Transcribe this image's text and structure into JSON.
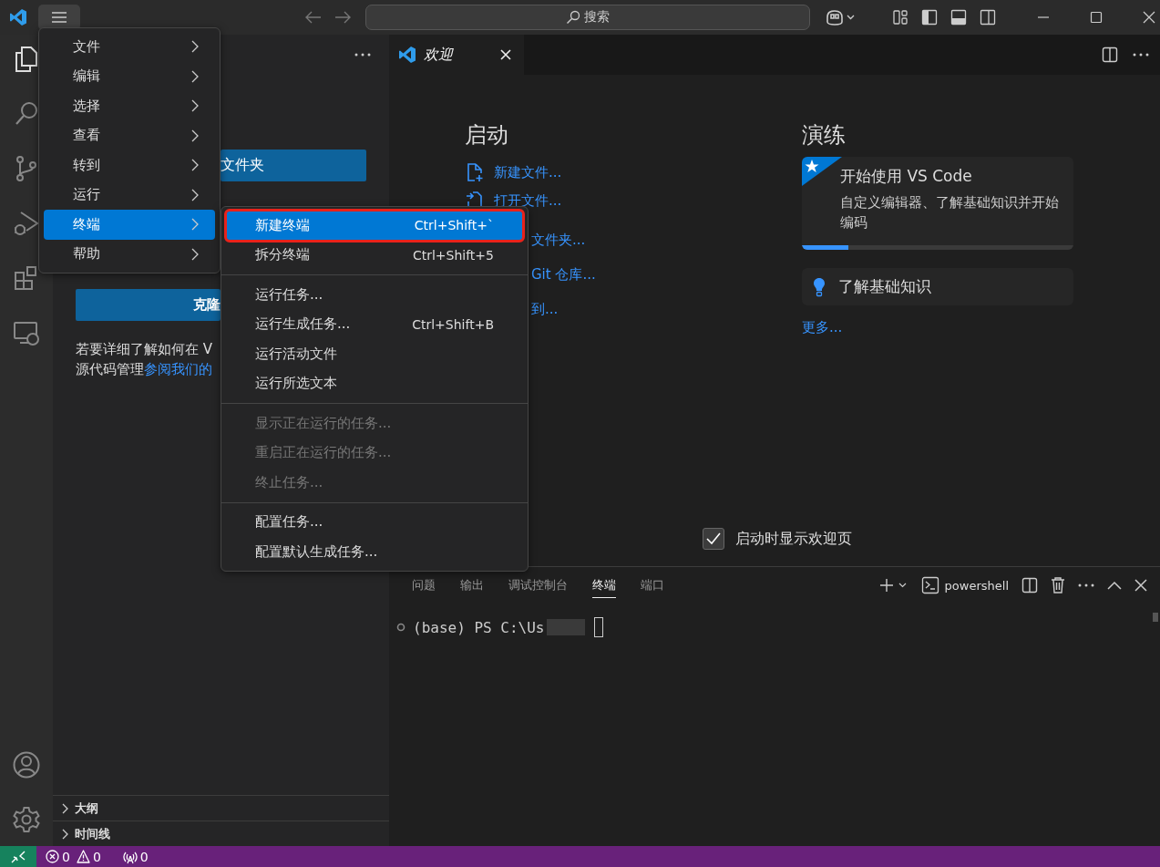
{
  "title_bar": {
    "search_placeholder": "搜索"
  },
  "sidebar": {
    "open_folder_button": "文件夹",
    "clone_button": "克隆",
    "help_line_1": "若要详细了解如何在 V",
    "help_line_2": "源代码管理",
    "help_link": "参阅我们的",
    "sections": [
      {
        "label": "大纲",
        "expanded": false
      },
      {
        "label": "时间线",
        "expanded": false
      }
    ]
  },
  "editor": {
    "tabs": [
      {
        "label": "欢迎",
        "selected": true
      }
    ],
    "start": {
      "title": "启动",
      "links": [
        {
          "kind": "new-file",
          "label": "新建文件..."
        },
        {
          "kind": "open-file",
          "label": "打开文件..."
        },
        {
          "kind": "clipped",
          "label": "文件夹..."
        },
        {
          "kind": "clipped",
          "label": "Git 仓库..."
        },
        {
          "kind": "clipped",
          "label": "到..."
        }
      ]
    },
    "walkthroughs": {
      "title": "演练",
      "cards": [
        {
          "kind": "featured",
          "title": "开始使用 VS Code",
          "description": "自定义编辑器、了解基础知识并开始编码",
          "level": 0.17
        },
        {
          "kind": "tip",
          "title": "了解基础知识"
        }
      ],
      "more_link": "更多..."
    },
    "show_on_startup": {
      "label": "启动时显示欢迎页",
      "checked": true
    }
  },
  "panel": {
    "tabs": [
      {
        "label": "问题",
        "selected": false
      },
      {
        "label": "输出",
        "selected": false
      },
      {
        "label": "调试控制台",
        "selected": false
      },
      {
        "label": "终端",
        "selected": true
      },
      {
        "label": "端口",
        "selected": false
      }
    ],
    "terminal_profile": "powershell",
    "terminal_line": "(base) PS C:\\Us"
  },
  "status_bar": {
    "errors": "0",
    "warnings": "0",
    "ports": "0"
  },
  "main_menu": {
    "items": [
      {
        "label": "文件",
        "selected": false
      },
      {
        "label": "编辑",
        "selected": false
      },
      {
        "label": "选择",
        "selected": false
      },
      {
        "label": "查看",
        "selected": false
      },
      {
        "label": "转到",
        "selected": false
      },
      {
        "label": "运行",
        "selected": false
      },
      {
        "label": "终端",
        "selected": true
      },
      {
        "label": "帮助",
        "selected": false
      }
    ]
  },
  "submenu": {
    "groups": [
      [
        {
          "label": "新建终端",
          "shortcut": "Ctrl+Shift+`",
          "selected": true,
          "disabled": false,
          "highlighted": true
        },
        {
          "label": "拆分终端",
          "shortcut": "Ctrl+Shift+5",
          "selected": false,
          "disabled": false,
          "highlighted": false
        }
      ],
      [
        {
          "label": "运行任务...",
          "selected": false,
          "disabled": false,
          "highlighted": false
        },
        {
          "label": "运行生成任务...",
          "shortcut": "Ctrl+Shift+B",
          "selected": false,
          "disabled": false,
          "highlighted": false
        },
        {
          "label": "运行活动文件",
          "selected": false,
          "disabled": false,
          "highlighted": false
        },
        {
          "label": "运行所选文本",
          "selected": false,
          "disabled": false,
          "highlighted": false
        }
      ],
      [
        {
          "label": "显示正在运行的任务...",
          "selected": false,
          "disabled": true,
          "highlighted": false
        },
        {
          "label": "重启正在运行的任务...",
          "selected": false,
          "disabled": true,
          "highlighted": false
        },
        {
          "label": "终止任务...",
          "selected": false,
          "disabled": true,
          "highlighted": false
        }
      ],
      [
        {
          "label": "配置任务...",
          "selected": false,
          "disabled": false,
          "highlighted": false
        },
        {
          "label": "配置默认生成任务...",
          "selected": false,
          "disabled": false,
          "highlighted": false
        }
      ]
    ]
  }
}
